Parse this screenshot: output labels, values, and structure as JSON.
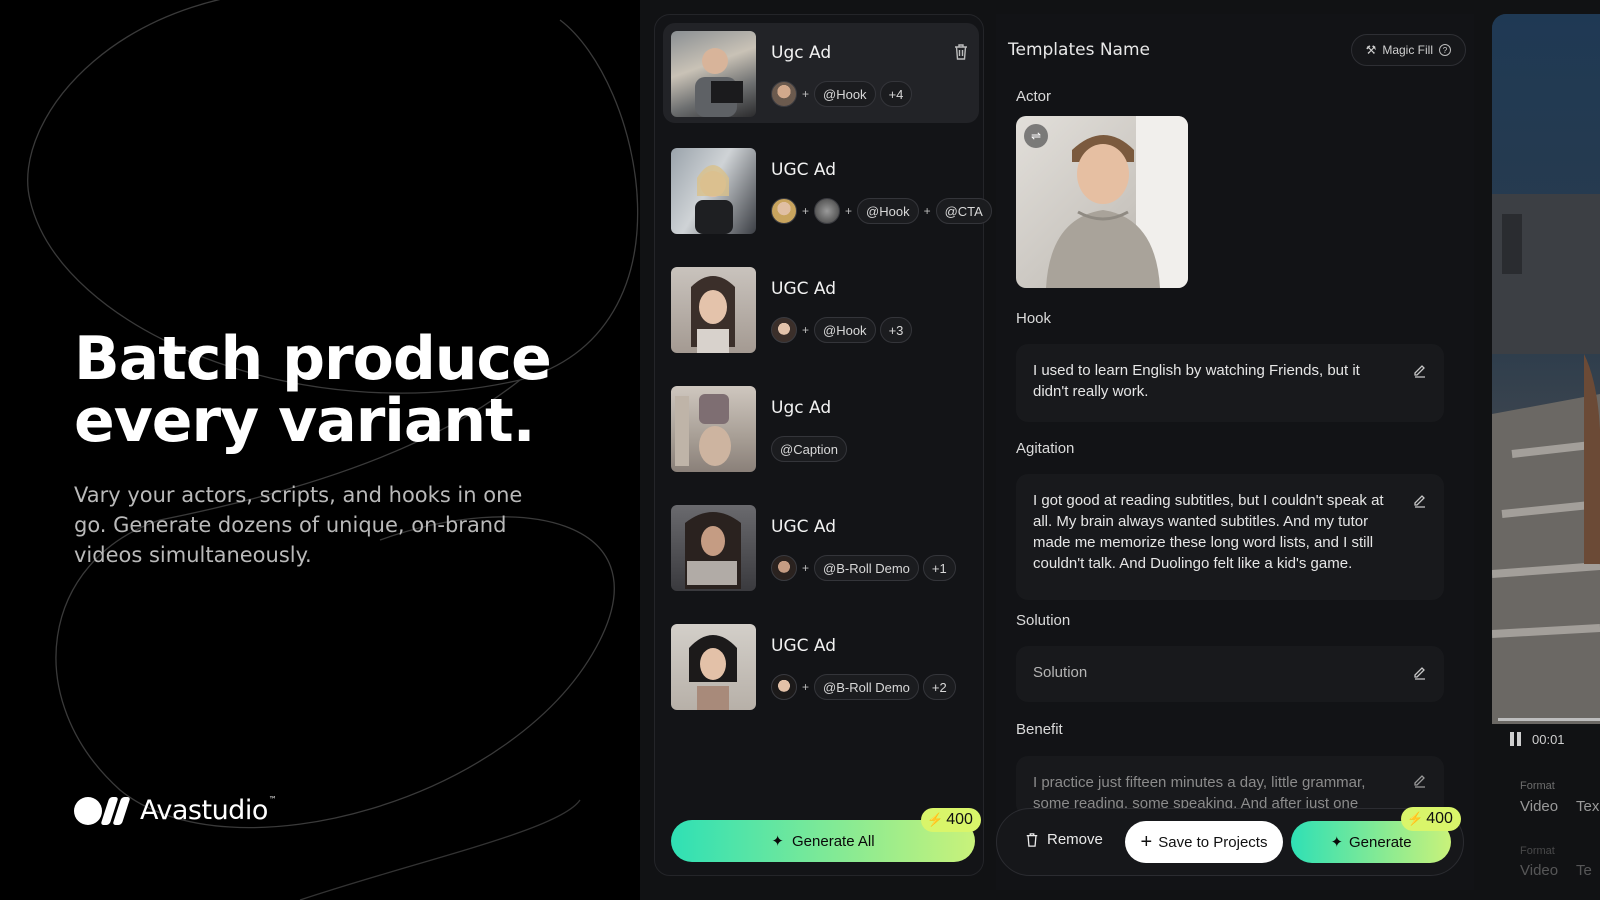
{
  "hero": {
    "title_line1": "Batch produce",
    "title_line2": "every variant.",
    "subtitle": "Vary your actors, scripts, and hooks in one go. Generate dozens of unique, on-brand videos simultaneously.",
    "brand_name": "Avastudio",
    "brand_tm": "™"
  },
  "templates": [
    {
      "title": "Ugc Ad",
      "tags": [
        "@Hook"
      ],
      "more": "+4"
    },
    {
      "title": "UGC Ad",
      "tags": [
        "@Hook",
        "@CTA"
      ]
    },
    {
      "title": "UGC Ad",
      "tags": [
        "@Hook"
      ],
      "more": "+3"
    },
    {
      "title": "Ugc Ad",
      "tags": [
        "@Caption"
      ]
    },
    {
      "title": "UGC Ad",
      "tags": [
        "@B-Roll Demo"
      ],
      "more": "+1"
    },
    {
      "title": "UGC Ad",
      "tags": [
        "@B-Roll Demo"
      ],
      "more": "+2"
    }
  ],
  "list_footer": {
    "generate_all_label": "Generate All",
    "credits": "400"
  },
  "editor": {
    "title": "Templates Name",
    "magic_fill_label": "Magic Fill",
    "actor_label": "Actor",
    "hook_label": "Hook",
    "hook_text": "I used to learn English by watching Friends, but it didn't really work.",
    "agitation_label": "Agitation",
    "agitation_text": "I got good at reading subtitles, but I couldn't speak at all. My brain always wanted subtitles. And my tutor made me memorize these long word lists, and I still couldn't talk. And Duolingo felt like a kid's game.",
    "solution_label": "Solution",
    "solution_placeholder": "Solution",
    "benefit_label": "Benefit",
    "benefit_text": "I practice just fifteen minutes a day, little grammar, some reading, some speaking. And after just one"
  },
  "actions": {
    "remove_label": "Remove",
    "save_label": "Save to Projects",
    "generate_label": "Generate",
    "credits": "400"
  },
  "preview": {
    "timecode": "00:01",
    "format_label": "Format",
    "format_value_video": "Video",
    "format_value_text": "Tex",
    "format_label_2": "Format",
    "format_value_video_2": "Video",
    "format_value_text_2": "Te"
  }
}
